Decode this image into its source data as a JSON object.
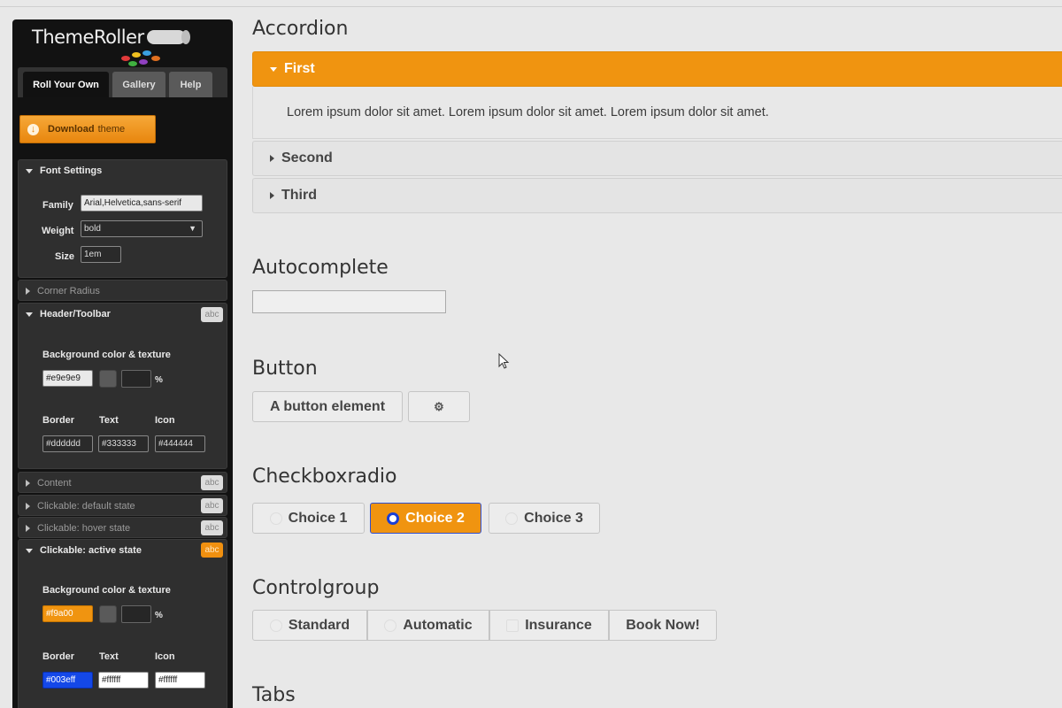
{
  "sidebar": {
    "logo": "ThemeRoller",
    "tabs": [
      "Roll Your Own",
      "Gallery",
      "Help"
    ],
    "download": {
      "label": "Download",
      "label_suffix": "theme"
    },
    "font_settings": {
      "title": "Font Settings",
      "family_label": "Family",
      "family_value": "Arial,Helvetica,sans-serif",
      "weight_label": "Weight",
      "weight_value": "bold",
      "size_label": "Size",
      "size_value": "1em"
    },
    "corner_radius": {
      "title": "Corner Radius"
    },
    "header_toolbar": {
      "title": "Header/Toolbar",
      "badge": "abc",
      "bg_label": "Background color & texture",
      "bg_value": "#e9e9e9",
      "pct": "%",
      "border_label": "Border",
      "text_label": "Text",
      "icon_label": "Icon",
      "border_value": "#dddddd",
      "text_value": "#333333",
      "icon_value": "#444444"
    },
    "content": {
      "title": "Content",
      "badge": "abc"
    },
    "clickable_default": {
      "title": "Clickable: default state",
      "badge": "abc"
    },
    "clickable_hover": {
      "title": "Clickable: hover state",
      "badge": "abc"
    },
    "clickable_active": {
      "title": "Clickable: active state",
      "badge": "abc",
      "bg_label": "Background color & texture",
      "bg_value": "#f9a00",
      "pct": "%",
      "border_label": "Border",
      "text_label": "Text",
      "icon_label": "Icon",
      "border_value": "#003eff",
      "text_value": "#ffffff",
      "icon_value": "#ffffff"
    }
  },
  "main": {
    "accordion": {
      "title": "Accordion",
      "items": [
        {
          "label": "First",
          "active": true
        },
        {
          "label": "Second",
          "active": false
        },
        {
          "label": "Third",
          "active": false
        }
      ],
      "content": "Lorem ipsum dolor sit amet. Lorem ipsum dolor sit amet. Lorem ipsum dolor sit amet."
    },
    "autocomplete": {
      "title": "Autocomplete",
      "value": ""
    },
    "button": {
      "title": "Button",
      "label": "A button element",
      "icon_button": "gear-icon"
    },
    "checkboxradio": {
      "title": "Checkboxradio",
      "choices": [
        "Choice 1",
        "Choice 2",
        "Choice 3"
      ],
      "selected": "Choice 2"
    },
    "controlgroup": {
      "title": "Controlgroup",
      "items": [
        "Standard",
        "Automatic",
        "Insurance",
        "Book Now!"
      ]
    },
    "tabs": {
      "title": "Tabs"
    }
  },
  "colors": {
    "accent": "#f09410",
    "active_border": "#003eff",
    "sidebar_bg": "#121212",
    "page_bg": "#e8e8e8"
  }
}
